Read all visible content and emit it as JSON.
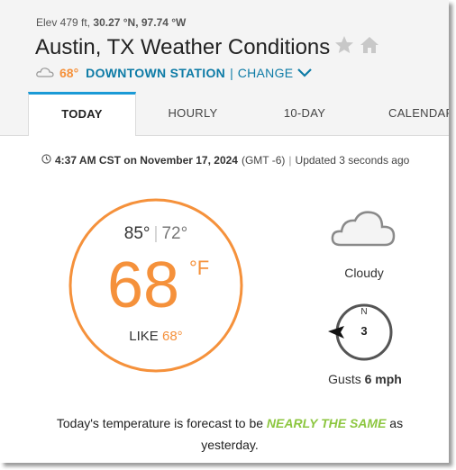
{
  "header": {
    "elevation": "Elev 479 ft,",
    "coordinates": "30.27 °N, 97.74 °W",
    "title": "Austin, TX Weather Conditions",
    "current_temp_short": "68°",
    "station": "DOWNTOWN STATION",
    "separator": "|",
    "change_label": "CHANGE"
  },
  "tabs": [
    {
      "label": "TODAY",
      "active": true
    },
    {
      "label": "HOURLY",
      "active": false
    },
    {
      "label": "10-DAY",
      "active": false
    },
    {
      "label": "CALENDAR",
      "active": false
    }
  ],
  "observation": {
    "time": "4:37 AM CST on November 17, 2024",
    "offset": "(GMT -6)",
    "separator": "|",
    "updated": "Updated 3 seconds ago"
  },
  "current": {
    "high": "85°",
    "divider": "|",
    "low": "72°",
    "temp": "68",
    "unit": "°F",
    "feels_like_label": "LIKE",
    "feels_like_value": "68°",
    "condition": "Cloudy",
    "wind_direction": "N",
    "wind_speed": "3",
    "gusts_label": "Gusts",
    "gusts_value": "6 mph"
  },
  "forecast": {
    "before": "Today's temperature is forecast to be",
    "highlight": "NEARLY THE SAME",
    "after": "as yesterday."
  },
  "colors": {
    "accent_orange": "#f5913b",
    "link_blue": "#0d7ba6",
    "tab_active_border": "#1b9ad6",
    "highlight_green": "#8cc63f"
  }
}
